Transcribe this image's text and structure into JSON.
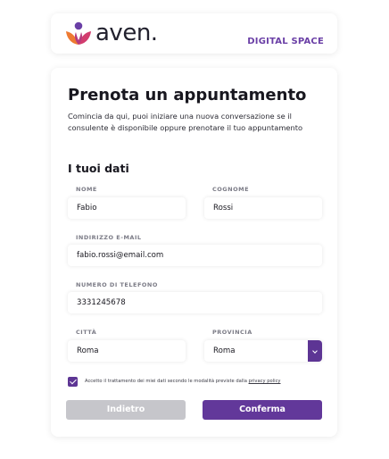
{
  "brand": {
    "name": "aven.",
    "tagline": "DIGITAL SPACE",
    "colors": {
      "accent": "#62389a",
      "logo_orange": "#ee7a32",
      "logo_pink": "#d23c6e",
      "logo_purple": "#6a3fa6"
    }
  },
  "page": {
    "title": "Prenota un appuntamento",
    "subtitle": "Comincia da qui, puoi iniziare una nuova conversazione se il consulente è disponibile oppure prenotare il tuo appuntamento",
    "section_title": "I tuoi dati"
  },
  "form": {
    "nome": {
      "label": "NOME",
      "value": "Fabio"
    },
    "cognome": {
      "label": "COGNOME",
      "value": "Rossi"
    },
    "email": {
      "label": "INDIRIZZO E-MAIL",
      "value": "fabio.rossi@email.com"
    },
    "telefono": {
      "label": "NUMERO DI TELEFONO",
      "value": "3331245678"
    },
    "citta": {
      "label": "CITTÀ",
      "value": "Roma"
    },
    "provincia": {
      "label": "PROVINCIA",
      "value": "Roma",
      "icon": "chevron-down-icon"
    },
    "consent": {
      "checked": true,
      "text": "Accetto il trattamento dei miei dati secondo le modalità previste dalla ",
      "link": "privacy policy"
    }
  },
  "buttons": {
    "back": "Indietro",
    "confirm": "Conferma"
  }
}
